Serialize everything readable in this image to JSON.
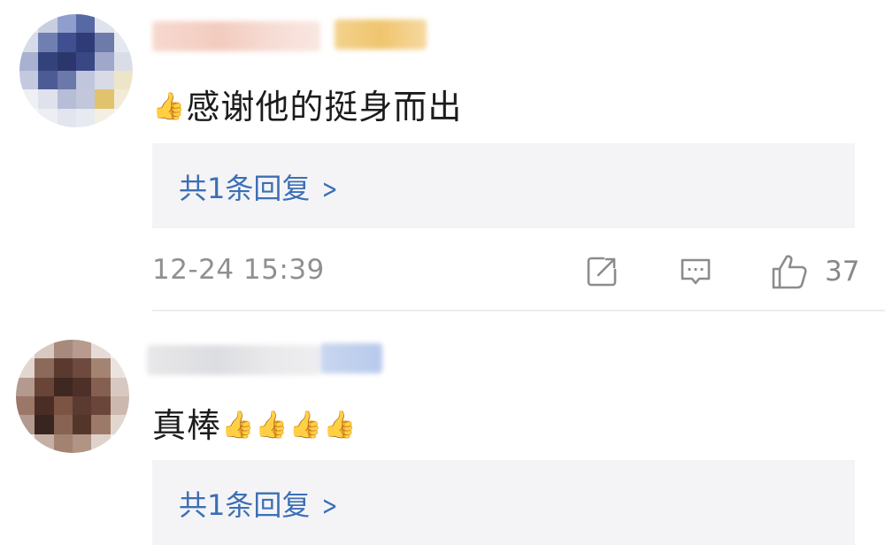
{
  "comments": [
    {
      "text": "感谢他的挺身而出",
      "leading_emoji": "👍",
      "reply_label": "共1条回复",
      "timestamp": "12-24 15:39",
      "like_count": "37",
      "icons": [
        "share-icon",
        "comment-icon",
        "thumbs-up-icon"
      ]
    },
    {
      "text": "真棒",
      "trailing_emoji": "👍👍👍👍",
      "reply_label": "共1条回复"
    }
  ],
  "colors": {
    "link": "#3c6fb5",
    "meta_text": "#909090",
    "reply_bg": "#f4f4f6"
  }
}
